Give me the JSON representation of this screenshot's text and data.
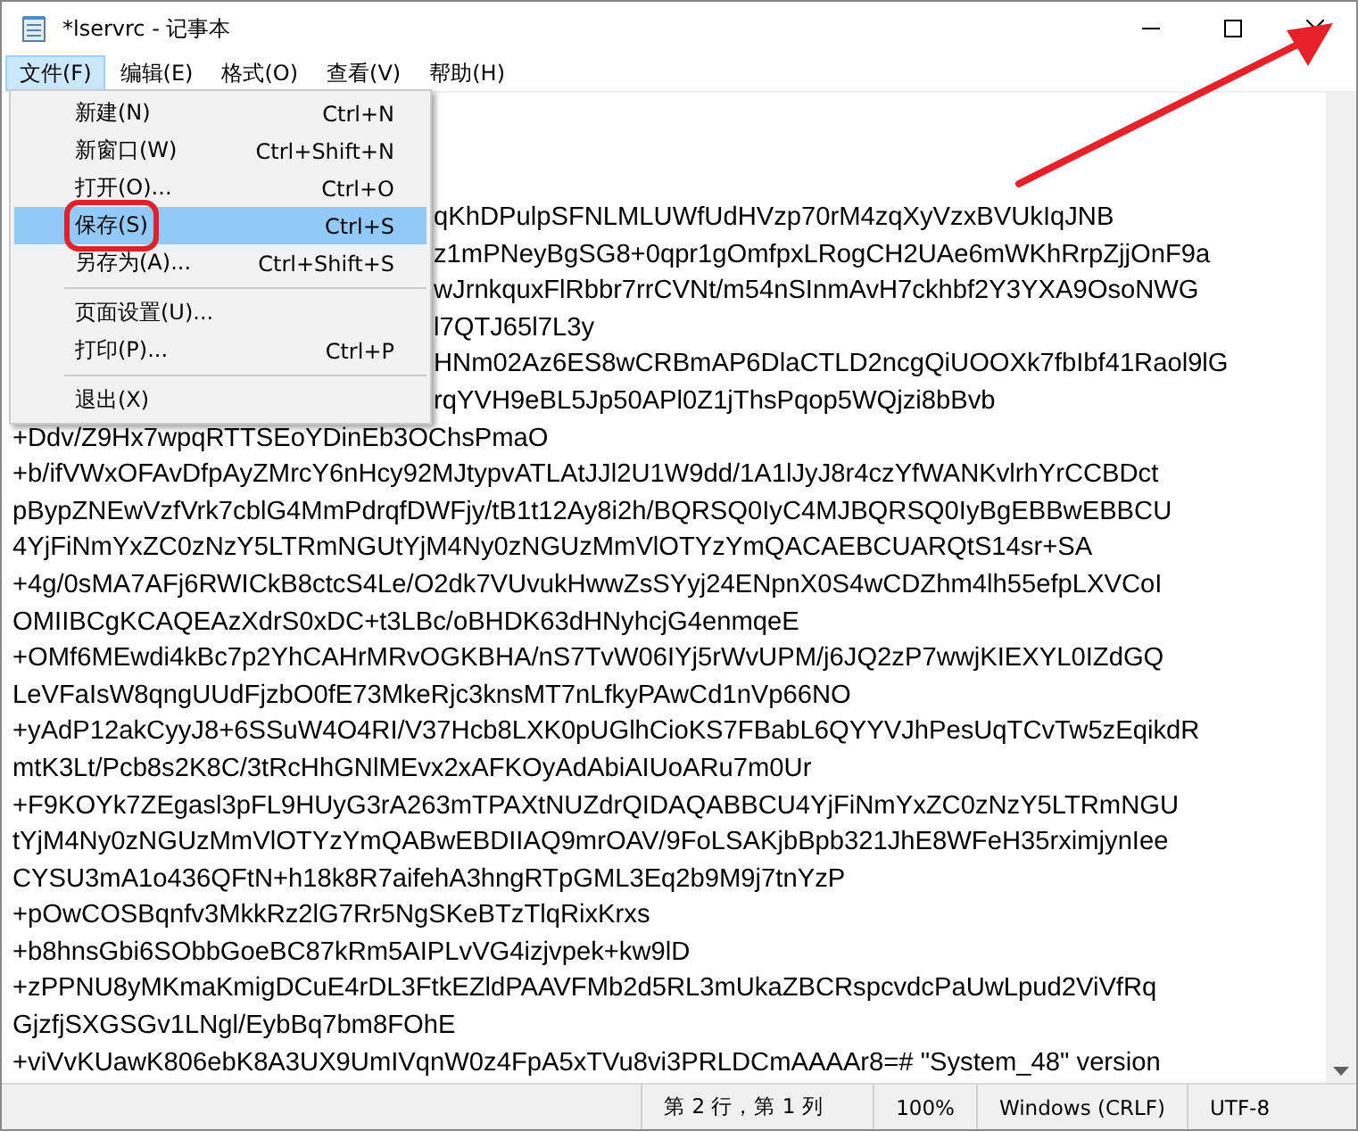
{
  "window": {
    "title": "*lservrc - 记事本"
  },
  "menubar": [
    {
      "label": "文件(F)",
      "selected": true
    },
    {
      "label": "编辑(E)",
      "selected": false
    },
    {
      "label": "格式(O)",
      "selected": false
    },
    {
      "label": "查看(V)",
      "selected": false
    },
    {
      "label": "帮助(H)",
      "selected": false
    }
  ],
  "file_menu": [
    {
      "kind": "item",
      "label": "新建(N)",
      "shortcut": "Ctrl+N",
      "selected": false,
      "boxed": false
    },
    {
      "kind": "item",
      "label": "新窗口(W)",
      "shortcut": "Ctrl+Shift+N",
      "selected": false,
      "boxed": false
    },
    {
      "kind": "item",
      "label": "打开(O)...",
      "shortcut": "Ctrl+O",
      "selected": false,
      "boxed": false
    },
    {
      "kind": "item",
      "label": "保存(S)",
      "shortcut": "Ctrl+S",
      "selected": true,
      "boxed": true
    },
    {
      "kind": "item",
      "label": "另存为(A)...",
      "shortcut": "Ctrl+Shift+S",
      "selected": false,
      "boxed": false
    },
    {
      "kind": "separator"
    },
    {
      "kind": "item",
      "label": "页面设置(U)...",
      "selected": false,
      "boxed": false
    },
    {
      "kind": "item",
      "label": "打印(P)...",
      "shortcut": "Ctrl+P",
      "selected": false,
      "boxed": false
    },
    {
      "kind": "separator"
    },
    {
      "kind": "item",
      "label": "退出(X)",
      "selected": false,
      "boxed": false
    }
  ],
  "editor_lines": [
    {
      "kind": "partial",
      "text": "qKhDPulpSFNLMLUWfUdHVzp70rM4zqXyVzxBVUkIqJNB"
    },
    {
      "kind": "partial",
      "text": "z1mPNeyBgSG8+0qpr1gOmfpxLRogCH2UAe6mWKhRrpZjjOnF9a"
    },
    {
      "kind": "partial",
      "text": "wJrnkquxFlRbbr7rrCVNt/m54nSInmAvH7ckhbf2Y3YXA9OsoNWG"
    },
    {
      "kind": "partial",
      "text": "l7QTJ65l7L3y"
    },
    {
      "kind": "partial",
      "text": "HNm02Az6ES8wCRBmAP6DlaCTLD2ncgQiUOOXk7fbIbf41Raol9lG"
    },
    {
      "kind": "partial",
      "text": "rqYVH9eBL5Jp50APl0Z1jThsPqop5WQjzi8bBvb"
    },
    {
      "kind": "full",
      "text": "+Ddv/Z9Hx7wpqRTTSEoYDinEb3OChsPmaO"
    },
    {
      "kind": "full",
      "text": "+b/ifVWxOFAvDfpAyZMrcY6nHcy92MJtypvATLAtJJl2U1W9dd/1A1lJyJ8r4czYfWANKvlrhYrCCBDct"
    },
    {
      "kind": "full",
      "text": "pBypZNEwVzfVrk7cblG4MmPdrqfDWFjy/tB1t12Ay8i2h/BQRSQ0IyC4MJBQRSQ0IyBgEBBwEBBCU"
    },
    {
      "kind": "full",
      "text": "4YjFiNmYxZC0zNzY5LTRmNGUtYjM4Ny0zNGUzMmVlOTYzYmQACAEBCUARQtS14sr+SA"
    },
    {
      "kind": "full",
      "text": "+4g/0sMA7AFj6RWICkB8ctcS4Le/O2dk7VUvukHwwZsSYyj24ENpnX0S4wCDZhm4lh55efpLXVCoI"
    },
    {
      "kind": "full",
      "text": "OMIIBCgKCAQEAzXdrS0xDC+t3LBc/oBHDK63dHNyhcjG4enmqeE"
    },
    {
      "kind": "full",
      "text": "+OMf6MEwdi4kBc7p2YhCAHrMRvOGKBHA/nS7TvW06IYj5rWvUPM/j6JQ2zP7wwjKIEXYL0IZdGQ"
    },
    {
      "kind": "full",
      "text": "LeVFaIsW8qngUUdFjzbO0fE73MkeRjc3knsMT7nLfkyPAwCd1nVp66NO"
    },
    {
      "kind": "full",
      "text": "+yAdP12akCyyJ8+6SSuW4O4RI/V37Hcb8LXK0pUGlhCioKS7FBabL6QYYVJhPesUqTCvTw5zEqikdR"
    },
    {
      "kind": "full",
      "text": "mtK3Lt/Pcb8s2K8C/3tRcHhGNlMEvx2xAFKOyAdAbiAIUoARu7m0Ur"
    },
    {
      "kind": "full",
      "text": "+F9KOYk7ZEgasl3pFL9HUyG3rA263mTPAXtNUZdrQIDAQABBCU4YjFiNmYxZC0zNzY5LTRmNGU"
    },
    {
      "kind": "full",
      "text": "tYjM4Ny0zNGUzMmVlOTYzYmQABwEBDIIAQ9mrOAV/9FoLSAKjbBpb321JhE8WFeH35rximjynIee"
    },
    {
      "kind": "full",
      "text": "CYSU3mA1o436QFtN+h18k8R7aifehA3hngRTpGML3Eq2b9M9j7tnYzP"
    },
    {
      "kind": "full",
      "text": "+pOwCOSBqnfv3MkkRz2lG7Rr5NgSKeBTzTlqRixKrxs"
    },
    {
      "kind": "full",
      "text": "+b8hnsGbi6SObbGoeBC87kRm5AIPLvVG4izjvpek+kw9lD"
    },
    {
      "kind": "full",
      "text": "+zPPNU8yMKmaKmigDCuE4rDL3FtkEZldPAAVFMb2d5RL3mUkaZBCRspcvdcPaUwLpud2ViVfRq"
    },
    {
      "kind": "full",
      "text": "GjzfjSXGSGv1LNgl/EybBq7bm8FOhE"
    },
    {
      "kind": "full",
      "text": "+viVvKUawK806ebK8A3UX9UmIVqnW0z4FpA5xTVu8vi3PRLDCmAAAAr8=# \"System_48\" version"
    }
  ],
  "status_bar": {
    "position": "第 2 行，第 1 列",
    "zoom": "100%",
    "line_ending": "Windows (CRLF)",
    "encoding": "UTF-8"
  }
}
